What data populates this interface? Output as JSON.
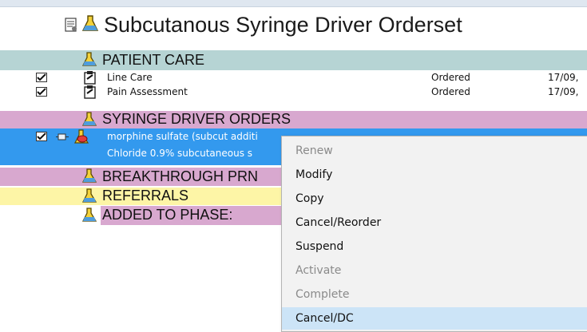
{
  "orderset": {
    "title": "Subcutanous Syringe Driver Orderset"
  },
  "sections": {
    "patient_care": "PATIENT CARE",
    "syringe_driver_orders": "SYRINGE DRIVER ORDERS",
    "breakthrough_prn": "BREAKTHROUGH PRN",
    "referrals": "REFERRALS",
    "added_to_phase": "ADDED TO PHASE:"
  },
  "orders": [
    {
      "name": "Line Care",
      "status": "Ordered",
      "date": "17/09,",
      "checked": true
    },
    {
      "name": "Pain Assessment",
      "status": "Ordered",
      "date": "17/09,",
      "checked": true
    },
    {
      "name_line1": "morphine sulfate (subcut additi",
      "name_line2": "Chloride 0.9% subcutaneous s",
      "checked": true,
      "selected": true
    }
  ],
  "context_menu": {
    "items": [
      {
        "label": "Renew",
        "enabled": false
      },
      {
        "label": "Modify",
        "enabled": true
      },
      {
        "label": "Copy",
        "enabled": true
      },
      {
        "label": "Cancel/Reorder",
        "enabled": true
      },
      {
        "label": "Suspend",
        "enabled": true
      },
      {
        "label": "Activate",
        "enabled": false
      },
      {
        "label": "Complete",
        "enabled": false
      },
      {
        "label": "Cancel/DC",
        "enabled": true,
        "highlighted": true
      }
    ]
  },
  "colors": {
    "patient_care_band": "#b6d4d4",
    "syringe_band": "#d8a8cf",
    "referrals_band": "#fdf5a6",
    "selected_row": "#3399ee",
    "menu_highlight": "#cce4f7"
  }
}
